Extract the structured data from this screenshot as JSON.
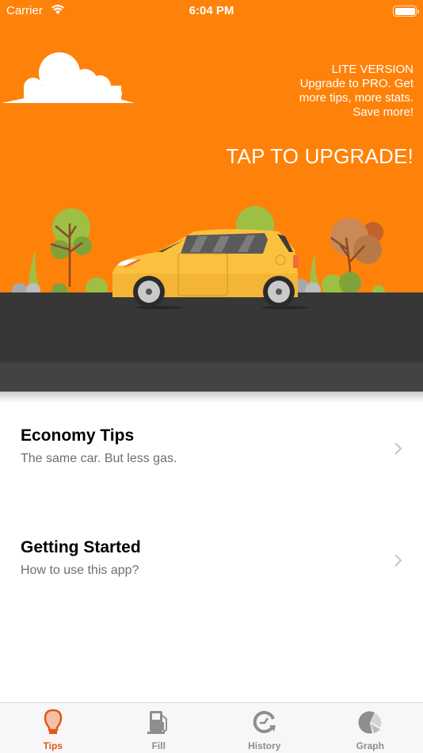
{
  "status_bar": {
    "carrier": "Carrier",
    "time": "6:04 PM",
    "wifi_icon": "wifi-icon",
    "battery_icon": "battery-icon"
  },
  "banner": {
    "promo_lines": [
      "LITE VERSION",
      "Upgrade to PRO. Get",
      "more tips, more stats.",
      "Save more!"
    ],
    "cta": "TAP TO UPGRADE!",
    "background_color": "#FE820A",
    "illustration": "car-road-scene"
  },
  "list": [
    {
      "title": "Economy Tips",
      "subtitle": "The same car. But less gas."
    },
    {
      "title": "Getting Started",
      "subtitle": "How to use this app?"
    }
  ],
  "tabbar": {
    "active_color": "#E4571B",
    "tabs": [
      {
        "label": "Tips",
        "icon": "lightbulb-icon",
        "active": true
      },
      {
        "label": "Fill",
        "icon": "fuel-pump-icon",
        "active": false
      },
      {
        "label": "History",
        "icon": "history-clock-icon",
        "active": false
      },
      {
        "label": "Graph",
        "icon": "pie-chart-icon",
        "active": false
      }
    ]
  }
}
